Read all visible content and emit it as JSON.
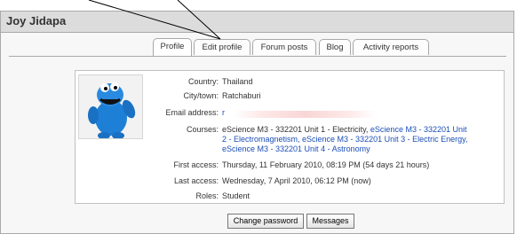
{
  "user": {
    "name": "Joy Jidapa"
  },
  "tabs": [
    {
      "label": "Profile"
    },
    {
      "label": "Edit profile"
    },
    {
      "label": "Forum posts"
    },
    {
      "label": "Blog"
    },
    {
      "label": "Activity reports"
    }
  ],
  "profile": {
    "country_label": "Country:",
    "country": "Thailand",
    "city_label": "City/town:",
    "city": "Ratchaburi",
    "email_label": "Email address:",
    "email_partial": "r",
    "courses_label": "Courses:",
    "courses_line1_a": "eScience M3 - 332201 Unit 1 - Electricity,",
    "courses_line1_b": "eScience M3 - 332201 Unit",
    "courses_line2": "2 - Electromagnetism, eScience M3 - 332201 Unit 3 - Electric Energy,",
    "courses_line3": "eScience M3 - 332201 Unit 4 - Astronomy",
    "first_access_label": "First access:",
    "first_access": "Thursday, 11 February 2010, 08:19 PM  (54 days 21 hours)",
    "last_access_label": "Last access:",
    "last_access": "Wednesday, 7 April 2010, 06:12 PM  (now)",
    "roles_label": "Roles:",
    "roles": "Student"
  },
  "buttons": {
    "change_password": "Change password",
    "messages": "Messages"
  },
  "colors": {
    "link": "#1a4fb8",
    "title_bar": "#dcdcdc",
    "panel": "#f7f7f7"
  }
}
